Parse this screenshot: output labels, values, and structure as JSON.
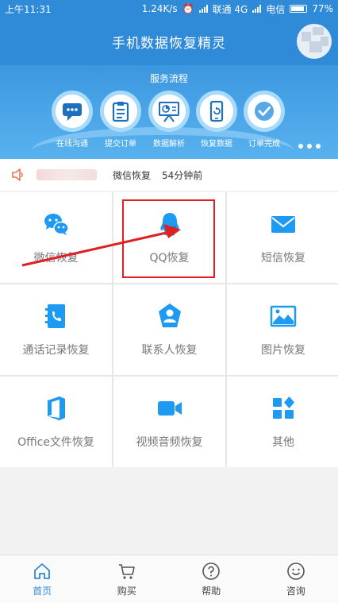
{
  "status_bar": {
    "time": "上午11:31",
    "speed": "1.24K/s",
    "carrier1": "联通 4G",
    "carrier2": "电信",
    "battery": "77%"
  },
  "header": {
    "title": "手机数据恢复精灵"
  },
  "process": {
    "title": "服务流程",
    "steps": [
      {
        "label": "在线沟通",
        "icon": "chat-bubble-icon"
      },
      {
        "label": "提交订单",
        "icon": "clipboard-icon"
      },
      {
        "label": "数据解析",
        "icon": "presentation-chart-icon"
      },
      {
        "label": "恢复数据",
        "icon": "phone-restore-icon"
      },
      {
        "label": "订单完成",
        "icon": "checkmark-icon"
      }
    ]
  },
  "notice": {
    "text": "微信恢复",
    "time": "54分钟前"
  },
  "grid": [
    {
      "label": "微信恢复",
      "icon": "wechat-icon"
    },
    {
      "label": "QQ恢复",
      "icon": "qq-icon"
    },
    {
      "label": "短信恢复",
      "icon": "envelope-icon"
    },
    {
      "label": "通话记录恢复",
      "icon": "call-log-icon"
    },
    {
      "label": "联系人恢复",
      "icon": "contact-icon"
    },
    {
      "label": "图片恢复",
      "icon": "image-icon"
    },
    {
      "label": "Office文件恢复",
      "icon": "office-icon"
    },
    {
      "label": "视频音频恢复",
      "icon": "video-camera-icon"
    },
    {
      "label": "其他",
      "icon": "apps-icon"
    }
  ],
  "bottom_nav": [
    {
      "label": "首页",
      "icon": "home-icon",
      "active": true
    },
    {
      "label": "购买",
      "icon": "cart-icon"
    },
    {
      "label": "帮助",
      "icon": "help-icon"
    },
    {
      "label": "咨询",
      "icon": "smile-icon"
    }
  ],
  "colors": {
    "primary": "#2f8ad8",
    "icon_blue": "#1e9af0",
    "annotation_red": "#e02020"
  }
}
